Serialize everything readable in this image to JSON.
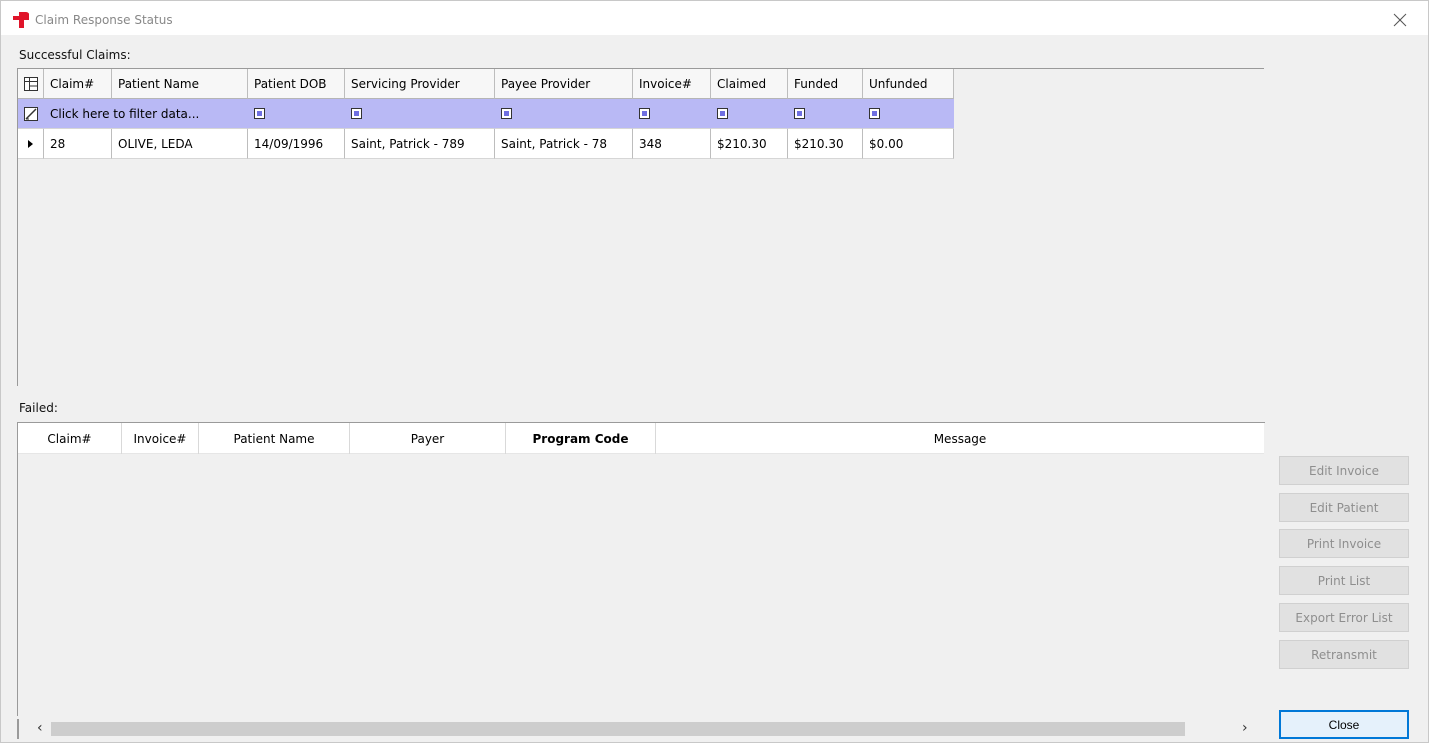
{
  "window": {
    "title": "Claim Response Status",
    "close_icon": "close-x-icon",
    "app_icon": "red-cross-p-icon",
    "accent_color": "#0078d7",
    "filter_row_color": "#b9b9f5"
  },
  "successful": {
    "label": "Successful Claims:",
    "columns": [
      "Claim#",
      "Patient Name",
      "Patient DOB",
      "Servicing Provider",
      "Payee Provider",
      "Invoice#",
      "Claimed",
      "Funded",
      "Unfunded"
    ],
    "filter_placeholder": "Click here to filter data...",
    "rows": [
      {
        "claim": "28",
        "patient_name": "OLIVE, LEDA",
        "patient_dob": "14/09/1996",
        "servicing_provider": "Saint, Patrick - 789",
        "payee_provider": "Saint, Patrick - 78",
        "invoice": "348",
        "claimed": "$210.30",
        "funded": "$210.30",
        "unfunded": "$0.00"
      }
    ]
  },
  "failed": {
    "label": "Failed:",
    "columns": [
      "Claim#",
      "Invoice#",
      "Patient Name",
      "Payer",
      "Program Code",
      "Message"
    ]
  },
  "buttons": {
    "edit_invoice": "Edit Invoice",
    "edit_patient": "Edit Patient",
    "print_invoice": "Print Invoice",
    "print_list": "Print List",
    "export_error_list": "Export Error List",
    "retransmit": "Retransmit",
    "close": "Close"
  },
  "scrollbar": {
    "left_arrow": "‹",
    "right_arrow": "›"
  }
}
